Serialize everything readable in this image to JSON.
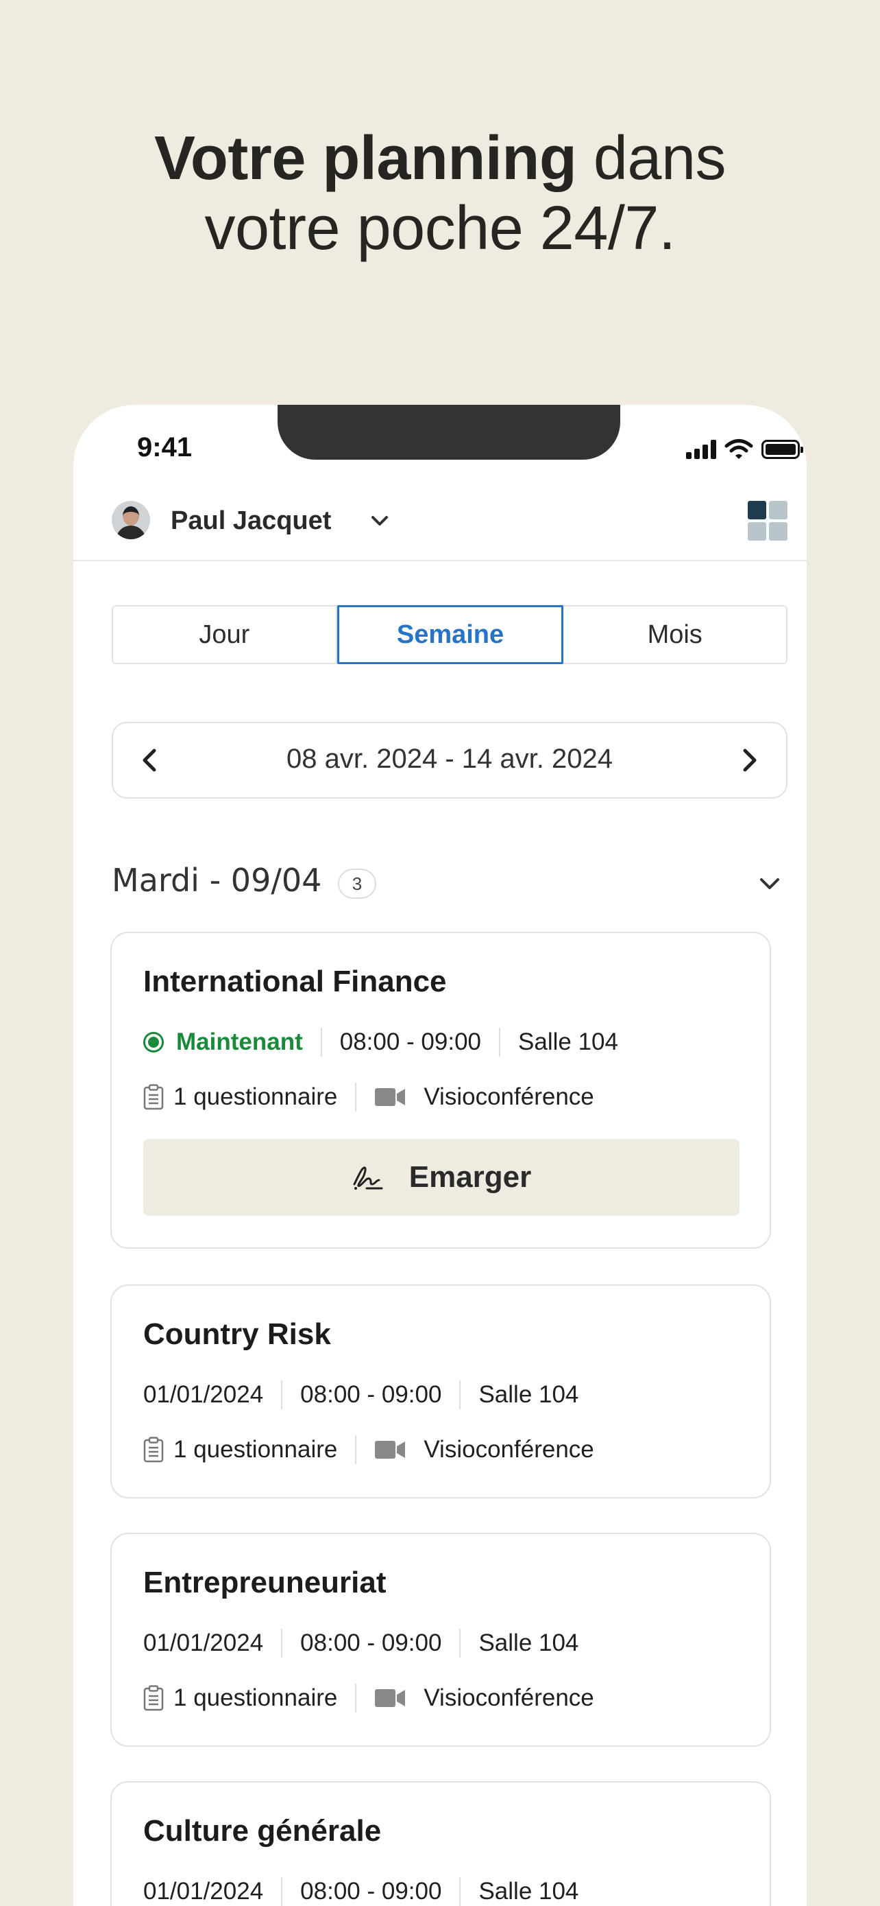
{
  "headline": {
    "bold": "Votre planning",
    "regular_1": " dans",
    "regular_2": "votre poche 24/7."
  },
  "status_bar": {
    "time": "9:41"
  },
  "header": {
    "user_name": "Paul Jacquet"
  },
  "view_tabs": [
    "Jour",
    "Semaine",
    "Mois"
  ],
  "active_tab": "Semaine",
  "date_range": "08 avr. 2024 - 14 avr. 2024",
  "day": {
    "title": "Mardi - 09/04",
    "count": "3"
  },
  "sessions": [
    {
      "title": "International Finance",
      "status": "Maintenant",
      "time": "08:00 - 09:00",
      "room": "Salle 104",
      "quiz": "1 questionnaire",
      "mode": "Visioconférence",
      "action": "Emarger"
    },
    {
      "title": "Country Risk",
      "date": "01/01/2024",
      "time": "08:00 - 09:00",
      "room": "Salle 104",
      "quiz": "1 questionnaire",
      "mode": "Visioconférence"
    },
    {
      "title": "Entrepreuneuriat",
      "date": "01/01/2024",
      "time": "08:00 - 09:00",
      "room": "Salle 104",
      "quiz": "1 questionnaire",
      "mode": "Visioconférence"
    },
    {
      "title": "Culture générale",
      "date": "01/01/2024",
      "time": "08:00 - 09:00",
      "room": "Salle 104"
    }
  ],
  "colors": {
    "background": "#efebe1",
    "accent_blue": "#2674c5",
    "live_green": "#1a8a3a",
    "dark_navy": "#1d3d4f"
  },
  "icons": [
    "chevron-down-icon",
    "grid-view-icon",
    "chevron-left-icon",
    "chevron-right-icon",
    "clipboard-icon",
    "video-camera-icon",
    "signature-icon",
    "live-status-icon"
  ]
}
